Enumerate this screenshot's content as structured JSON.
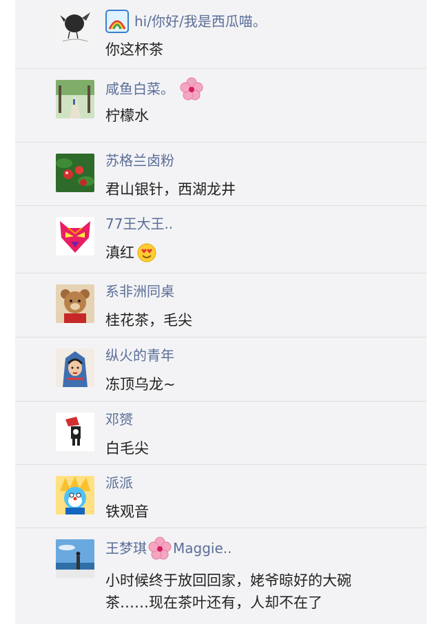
{
  "comments": [
    {
      "name": "hi/你好/我是西瓜喵。",
      "text": "你这杯茶",
      "name_prefix_icon": "rainbow-icon",
      "avatar_icon": "bird-sketch-avatar"
    },
    {
      "name": "咸鱼白菜。",
      "text": "柠檬水",
      "name_suffix_icon": "cherry-blossom-icon",
      "avatar_icon": "tree-path-avatar"
    },
    {
      "name": "苏格兰卤粉",
      "text": "君山银针，西湖龙井",
      "avatar_icon": "red-berries-avatar"
    },
    {
      "name": "77王大王..",
      "text": "滇红",
      "text_suffix_icon": "heart-eyes-face-icon",
      "avatar_icon": "tiger-face-avatar"
    },
    {
      "name": "系非洲同桌",
      "text": "桂花茶，毛尖",
      "avatar_icon": "teddy-bear-avatar"
    },
    {
      "name": "纵火的青年",
      "text": "冻顶乌龙~",
      "avatar_icon": "painted-figure-avatar"
    },
    {
      "name": "邓赟",
      "text": "白毛尖",
      "avatar_icon": "cartoon-character-avatar"
    },
    {
      "name": "派派",
      "text": "铁观音",
      "avatar_icon": "cartoon-hero-avatar"
    },
    {
      "name_part1": "王梦琪",
      "name_part2": "Maggie..",
      "name_middle_icon": "cherry-blossom-icon",
      "text_line1": "小时候终于放回回家，姥爷晾好的大碗",
      "text_line2": "茶……现在茶叶还有，人却不在了",
      "avatar_icon": "seaside-sky-avatar"
    }
  ],
  "colors": {
    "name": "#5a6e98",
    "comment_text": "#222222",
    "list_background": "#f3f3f5",
    "divider": "#dedede",
    "blossom": "#f4a6c1"
  }
}
